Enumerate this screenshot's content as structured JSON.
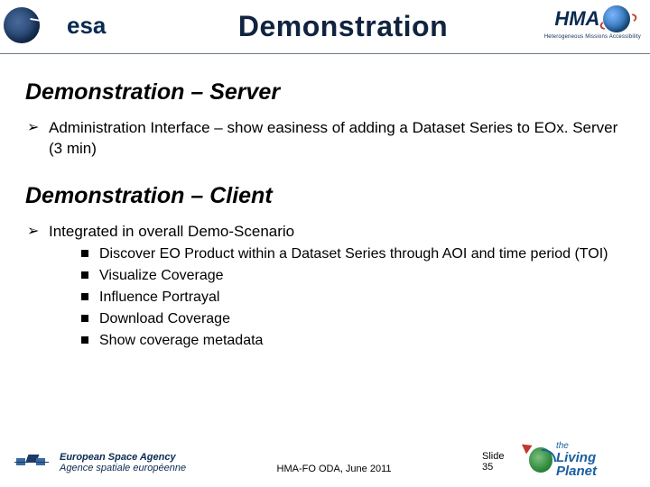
{
  "header": {
    "esa_text": "esa",
    "title": "Demonstration",
    "hma_text": "HMA",
    "hma_sub": "Heterogeneous Missions Accessibility"
  },
  "sections": {
    "server": {
      "title": "Demonstration – Server",
      "bullet1": "Administration Interface – show easiness of adding a Dataset Series to EOx. Server (3 min)"
    },
    "client": {
      "title": "Demonstration – Client",
      "bullet1": "Integrated in overall Demo-Scenario",
      "sub1": "Discover EO Product within a Dataset Series through AOI and time period (TOI)",
      "sub2": "Visualize Coverage",
      "sub3": "Influence Portrayal",
      "sub4": "Download Coverage",
      "sub5": "Show coverage metadata"
    }
  },
  "footer": {
    "esa_line1": "European Space Agency",
    "esa_line2": "Agence spatiale européenne",
    "center": "HMA-FO ODA, June 2011",
    "slide": "Slide 35",
    "lp_the": "the",
    "lp_text": "Living Planet"
  }
}
